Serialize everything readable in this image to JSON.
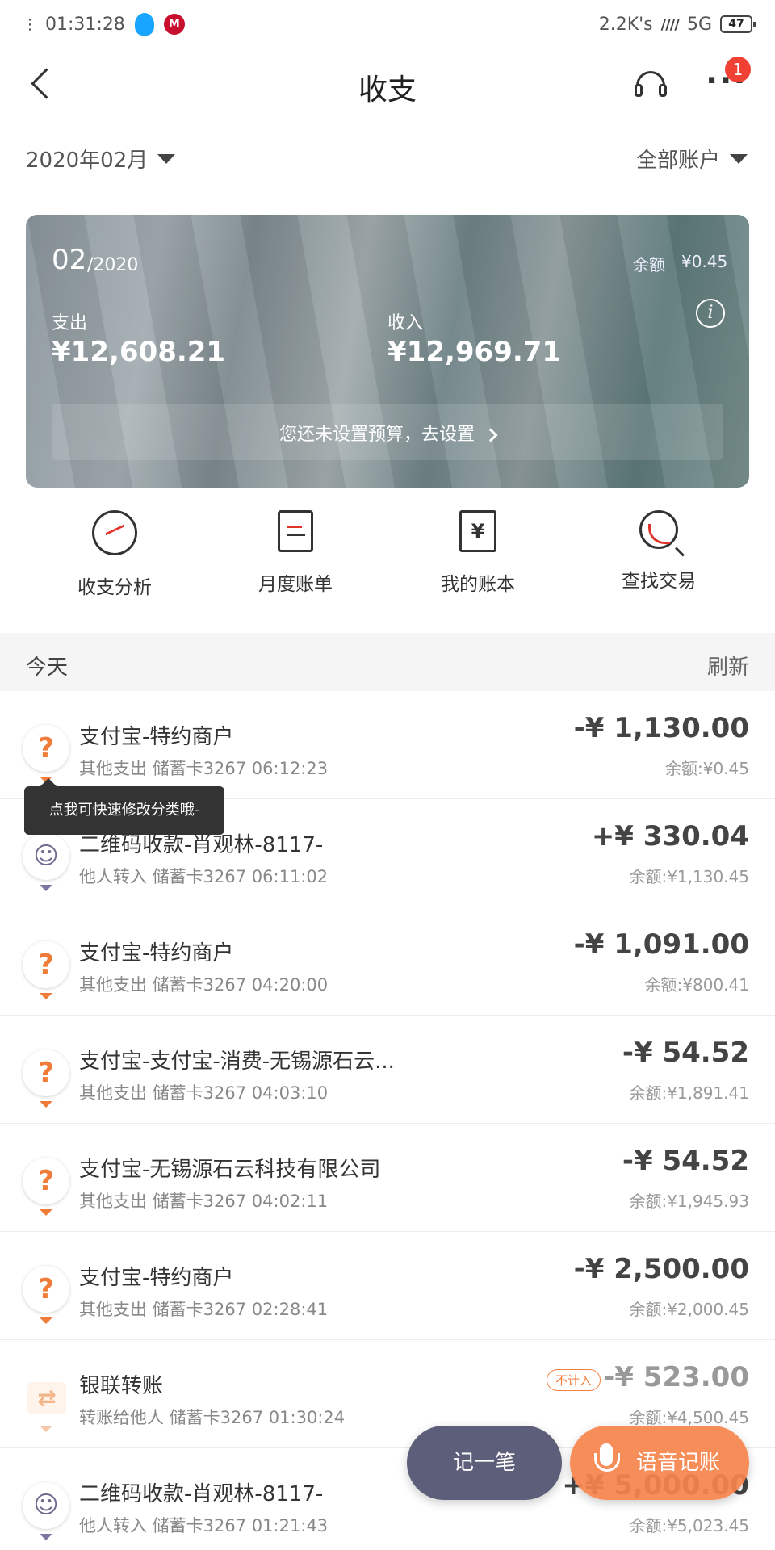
{
  "status_bar": {
    "time": "01:31:28",
    "network_speed": "2.2K's",
    "network_type": "5G",
    "battery": "47"
  },
  "header": {
    "title": "收支",
    "notification_count": "1"
  },
  "filters": {
    "month": "2020年02月",
    "account": "全部账户"
  },
  "summary": {
    "month": "02",
    "year": "/2020",
    "balance_label": "余额",
    "balance_value": "¥0.45",
    "expense_label": "支出",
    "expense_value": "¥12,608.21",
    "income_label": "收入",
    "income_value": "¥12,969.71",
    "budget_prompt": "您还未设置预算，去设置"
  },
  "actions": [
    {
      "label": "收支分析",
      "icon": "analysis-icon"
    },
    {
      "label": "月度账单",
      "icon": "bill-icon"
    },
    {
      "label": "我的账本",
      "icon": "ledger-icon"
    },
    {
      "label": "查找交易",
      "icon": "search-icon"
    }
  ],
  "section": {
    "today_label": "今天",
    "refresh_label": "刷新"
  },
  "tooltip": "点我可快速修改分类哦-",
  "transactions": [
    {
      "title": "支付宝-特约商户",
      "category": "其他支出",
      "card": "储蓄卡3267 06:12:23",
      "amount": "-¥ 1,130.00",
      "balance": "余额:¥0.45",
      "icon": "?"
    },
    {
      "title": "二维码收款-肖观林-8117-",
      "category": "他人转入",
      "card": "储蓄卡3267 06:11:02",
      "amount": "+¥ 330.04",
      "balance": "余额:¥1,130.45",
      "icon": "person"
    },
    {
      "title": "支付宝-特约商户",
      "category": "其他支出",
      "card": "储蓄卡3267 04:20:00",
      "amount": "-¥ 1,091.00",
      "balance": "余额:¥800.41",
      "icon": "?"
    },
    {
      "title": "支付宝-支付宝-消费-无锡源石云...",
      "category": "其他支出",
      "card": "储蓄卡3267 04:03:10",
      "amount": "-¥ 54.52",
      "balance": "余额:¥1,891.41",
      "icon": "?"
    },
    {
      "title": "支付宝-无锡源石云科技有限公司",
      "category": "其他支出",
      "card": "储蓄卡3267 04:02:11",
      "amount": "-¥ 54.52",
      "balance": "余额:¥1,945.93",
      "icon": "?"
    },
    {
      "title": "支付宝-特约商户",
      "category": "其他支出",
      "card": "储蓄卡3267 02:28:41",
      "amount": "-¥ 2,500.00",
      "balance": "余额:¥2,000.45",
      "icon": "?"
    },
    {
      "title": "银联转账",
      "category": "转账给他人",
      "card": "储蓄卡3267 01:30:24",
      "amount": "-¥ 523.00",
      "balance": "余额:¥4,500.45",
      "icon": "transfer",
      "tag": "不计入"
    },
    {
      "title": "二维码收款-肖观林-8117-",
      "category": "他人转入",
      "card": "储蓄卡3267 01:21:43",
      "amount": "+¥ 5,000.00",
      "balance": "余额:¥5,023.45",
      "icon": "person"
    }
  ],
  "fab": {
    "record_label": "记一笔",
    "voice_label": "语音记账"
  }
}
